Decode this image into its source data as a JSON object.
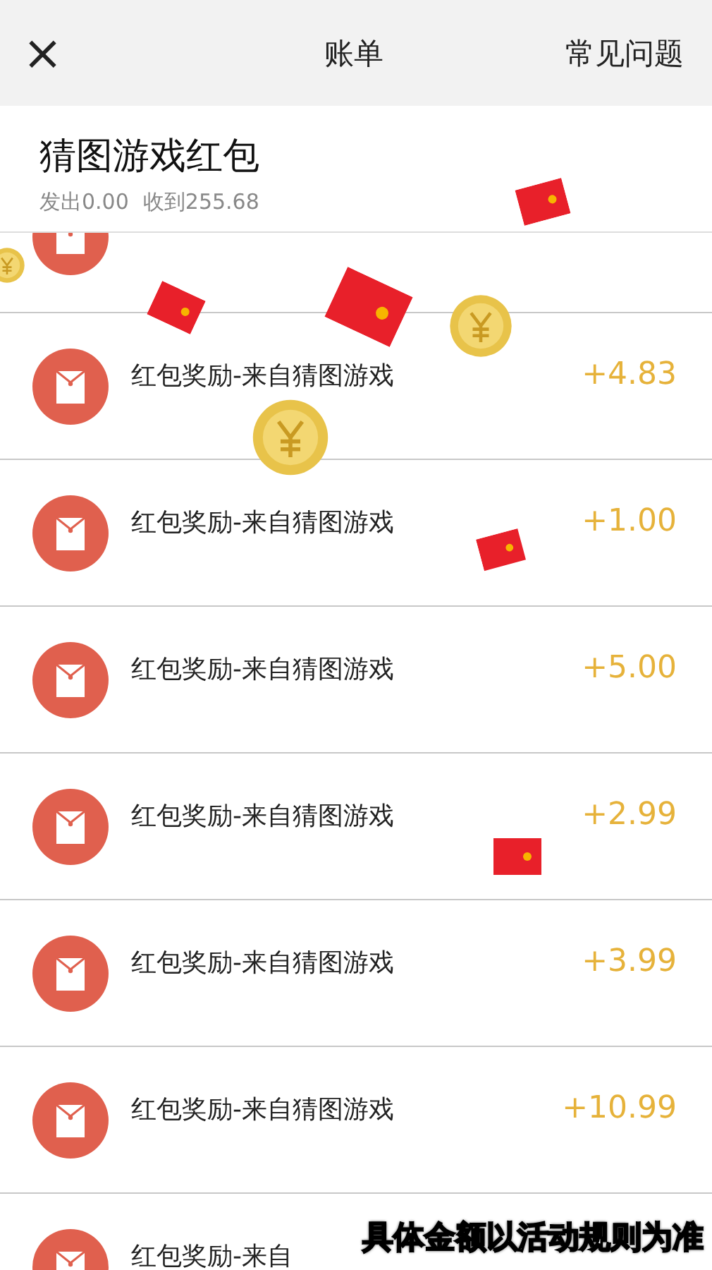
{
  "header": {
    "close": "×",
    "title": "账单",
    "help": "常见问题"
  },
  "summary": {
    "title": "猜图游戏红包",
    "sent": "发出0.00",
    "received": "收到255.68"
  },
  "records": [
    {
      "title": "红包奖励-来自猜图游戏",
      "amount": "+4.83"
    },
    {
      "title": "红包奖励-来自猜图游戏",
      "amount": "+1.00"
    },
    {
      "title": "红包奖励-来自猜图游戏",
      "amount": "+5.00"
    },
    {
      "title": "红包奖励-来自猜图游戏",
      "amount": "+2.99"
    },
    {
      "title": "红包奖励-来自猜图游戏",
      "amount": "+3.99"
    },
    {
      "title": "红包奖励-来自猜图游戏",
      "amount": "+10.99"
    },
    {
      "title": "红包奖励-来自"
    }
  ],
  "caption": "具体金额以活动规则为准"
}
